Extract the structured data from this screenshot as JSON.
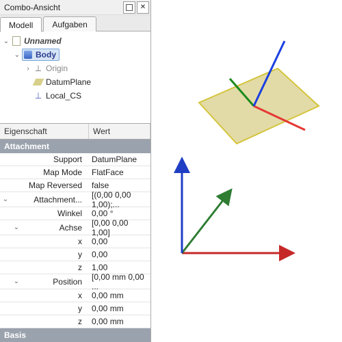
{
  "titlebar": {
    "title": "Combo-Ansicht"
  },
  "tabs": {
    "model": "Modell",
    "tasks": "Aufgaben"
  },
  "tree": {
    "unnamed": "Unnamed",
    "body": "Body",
    "origin": "Origin",
    "datumplane": "DatumPlane",
    "localcs": "Local_CS"
  },
  "prop": {
    "header": {
      "property": "Eigenschaft",
      "value": "Wert"
    },
    "attachment": {
      "group": "Attachment",
      "support": {
        "k": "Support",
        "v": "DatumPlane"
      },
      "mapmode": {
        "k": "Map Mode",
        "v": "FlatFace"
      },
      "maprev": {
        "k": "Map Reversed",
        "v": "false"
      },
      "offset": {
        "k": "Attachment...",
        "v": "[(0,00 0,00 1,00);..."
      },
      "winkel": {
        "k": "Winkel",
        "v": "0,00 °"
      },
      "achse": {
        "k": "Achse",
        "v": "[0,00 0,00 1,00]"
      },
      "ax": {
        "k": "x",
        "v": "0,00"
      },
      "ay": {
        "k": "y",
        "v": "0,00"
      },
      "az": {
        "k": "z",
        "v": "1,00"
      },
      "position": {
        "k": "Position",
        "v": "[0,00 mm  0,00 ..."
      },
      "px": {
        "k": "x",
        "v": "0,00 mm"
      },
      "py": {
        "k": "y",
        "v": "0,00 mm"
      },
      "pz": {
        "k": "z",
        "v": "0,00 mm"
      }
    },
    "basis": {
      "group": "Basis"
    }
  },
  "chart_data": {
    "type": "other",
    "description": "3D viewport showing global origin axes (red X, green Y, blue Z) and a tilted datum plane (tan quad) with a local coordinate system (red/green/blue axes) attached flat-face to it."
  }
}
